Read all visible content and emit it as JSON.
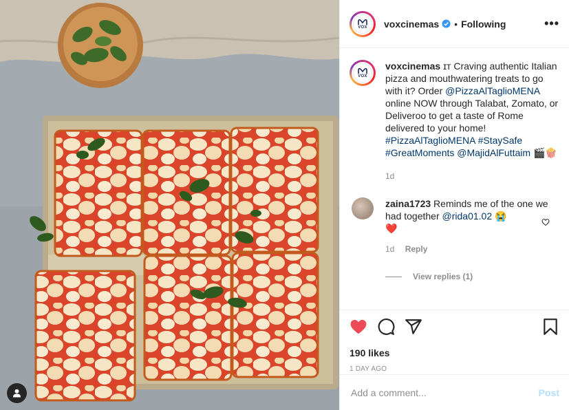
{
  "post": {
    "author": "voxcinemas",
    "avatar_text": "VOX",
    "follow_status": "Following",
    "more_label": "•••",
    "caption_prefix": "ɪᴛ Craving authentic Italian pizza and mouthwatering treats to go with it? Order ",
    "caption_mention_1": "@PizzaAlTaglioMENA",
    "caption_mid": " online NOW through Talabat, Zomato, or Deliveroo to get a taste of Rome delivered to your home! ",
    "caption_tags": "#PizzaAlTaglioMENA #StaySafe #GreatMoments",
    "caption_mention_2": "@MajidAlFuttaim",
    "caption_emojis": " 🎬🍿",
    "caption_age": "1d",
    "likes": "190 likes",
    "date": "1 DAY AGO"
  },
  "comment": {
    "author": "zaina1723",
    "text_prefix": " Reminds me of the one we had together ",
    "mention": "@rida01.02",
    "text_suffix": " 😭",
    "emoji_line": "❤️",
    "age": "1d",
    "reply_label": "Reply",
    "view_replies": "View replies (1)"
  },
  "composer": {
    "placeholder": "Add a comment...",
    "post_label": "Post"
  },
  "colors": {
    "like_red": "#ed4956",
    "link_blue": "#00376b",
    "post_disabled": "#b2dffc",
    "verified_blue": "#3897f0"
  },
  "icons": [
    "user-tag-icon",
    "verified-icon",
    "more-icon",
    "heart-icon",
    "comment-icon",
    "share-icon",
    "bookmark-icon",
    "like-comment-icon"
  ]
}
